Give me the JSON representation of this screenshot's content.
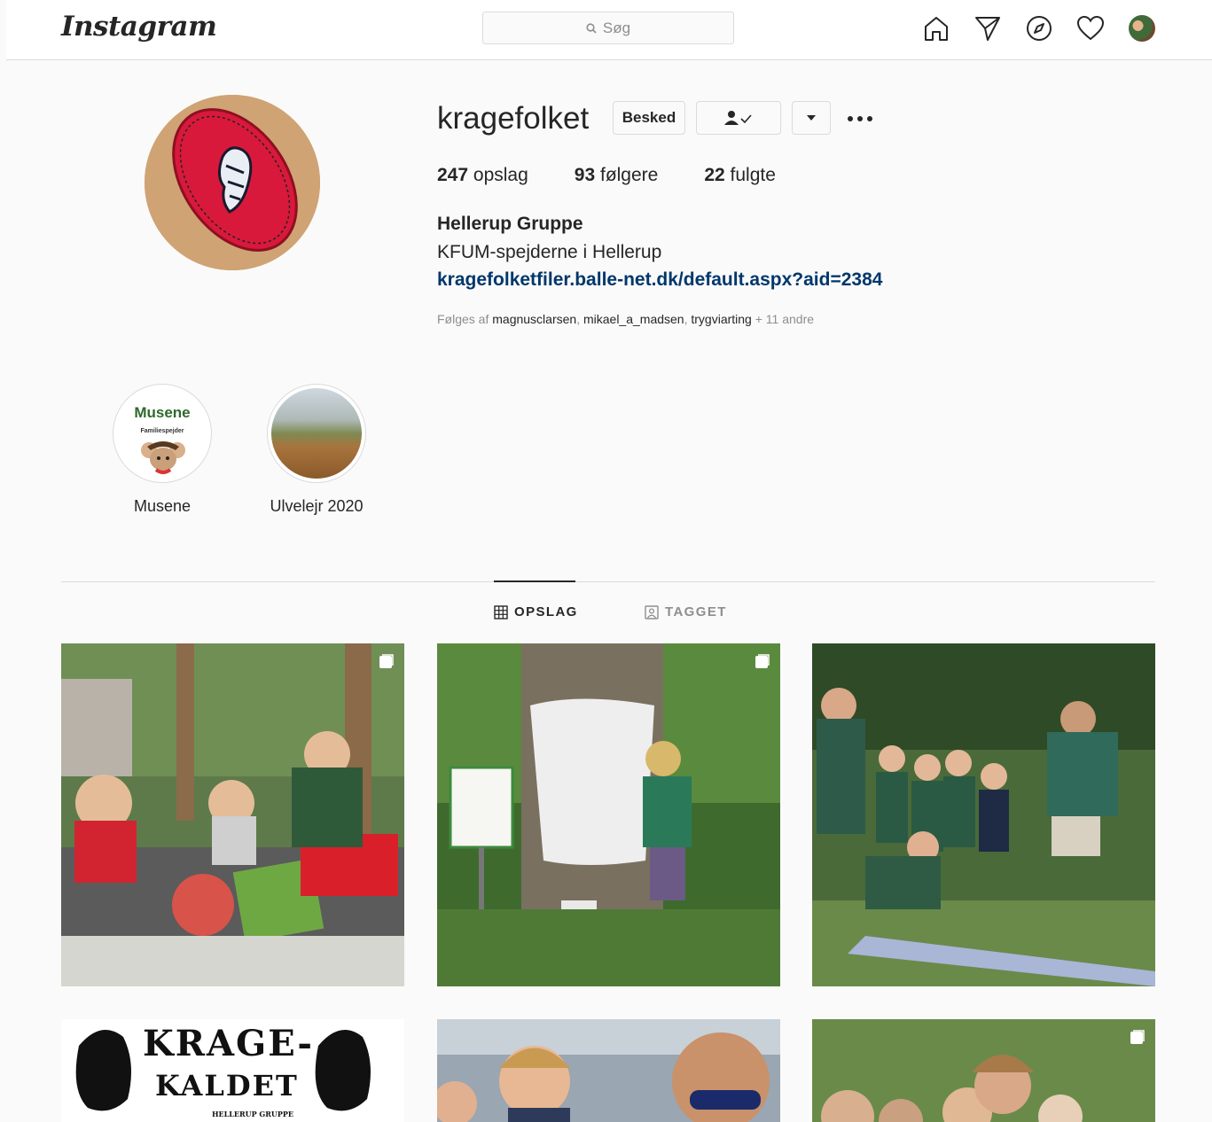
{
  "nav": {
    "logo_text": "Instagram",
    "search_placeholder": "Søg",
    "icons": [
      "home-icon",
      "direct-send-icon",
      "explore-compass-icon",
      "activity-heart-icon",
      "profile-avatar"
    ]
  },
  "profile": {
    "username": "kragefolket",
    "message_button": "Besked",
    "stats": {
      "posts_count": "247",
      "posts_label": "opslag",
      "followers_count": "93",
      "followers_label": "følgere",
      "following_count": "22",
      "following_label": "fulgte"
    },
    "full_name": "Hellerup Gruppe",
    "bio": "KFUM-spejderne i Hellerup",
    "website": "kragefolketfiler.balle-net.dk/default.aspx?aid=2384",
    "followed_by": {
      "prefix": "Følges af ",
      "users": [
        "magnusclarsen",
        "mikael_a_madsen",
        "trygviarting"
      ],
      "sep": ", ",
      "suffix": " + 11 andre"
    }
  },
  "highlights": [
    {
      "label": "Musene",
      "cover_title": "Musene",
      "cover_subtitle": "Familiespejder"
    },
    {
      "label": "Ulvelejr 2020"
    }
  ],
  "tabs": [
    {
      "label": "OPSLAG",
      "active": true
    },
    {
      "label": "TAGGET",
      "active": false
    }
  ],
  "posts_row2_text": {
    "title_line1": "KRAGE-",
    "title_line2": "KALDET",
    "subtitle": "HELLERUP GRUPPE"
  },
  "colors": {
    "link": "#00376b",
    "border": "#dbdbdb",
    "muted": "#8e8e8e",
    "text": "#262626"
  }
}
